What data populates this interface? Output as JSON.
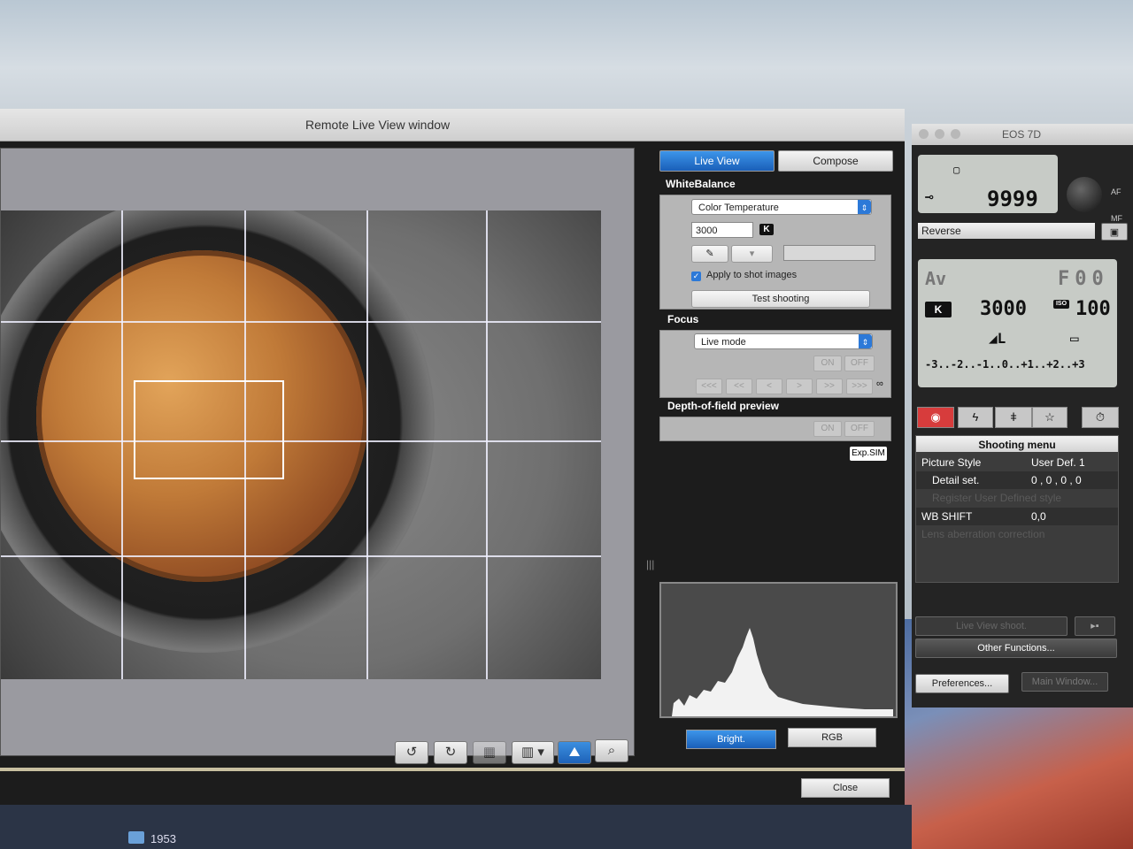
{
  "window_title": "Remote Live View window",
  "toolbar": {
    "rotate_left_icon": "rotate-left-icon",
    "rotate_right_icon": "rotate-right-icon",
    "grid_icon": "grid-icon",
    "aspect_label": "▾",
    "zoom_icon": "magnifier-icon"
  },
  "tabs": {
    "live_view": "Live View",
    "compose": "Compose"
  },
  "white_balance": {
    "label": "WhiteBalance",
    "mode": "Color Temperature",
    "kelvin_value": "3000",
    "kelvin_badge": "K",
    "apply_label": "Apply to shot images",
    "test_button": "Test shooting"
  },
  "focus": {
    "label": "Focus",
    "mode": "Live mode",
    "on": "ON",
    "off": "OFF",
    "steps": [
      "<<<",
      "<<",
      "<",
      ">",
      ">>",
      ">>>"
    ],
    "infinity": "∞"
  },
  "dof": {
    "label": "Depth-of-field preview",
    "on": "ON",
    "off": "OFF"
  },
  "expsim": "Exp.SIM",
  "histogram": {
    "bright_button": "Bright.",
    "rgb_button": "RGB"
  },
  "close_button": "Close",
  "eos": {
    "title": "EOS 7D",
    "shots_remaining": "9999",
    "af_label": "AF",
    "mf_label": "MF",
    "reverse_label": "Reverse",
    "mode": "Av",
    "aperture": "F00",
    "k_badge": "K",
    "white_balance_k": "3000",
    "iso_label": "ISO",
    "iso": "100",
    "exposure_scale": "-3..-2..-1..0..+1..+2..+3",
    "menu": {
      "header": "Shooting menu",
      "rows": [
        {
          "label": "Picture Style",
          "value": "User Def. 1"
        },
        {
          "label": "Detail set.",
          "value": "0 , 0 , 0 , 0"
        },
        {
          "label": "Register User Defined style",
          "value": ""
        },
        {
          "label": "WB SHIFT",
          "value": "0,0"
        },
        {
          "label": "Lens aberration correction",
          "value": ""
        }
      ]
    },
    "live_view_shoot": "Live View shoot.",
    "other_functions": "Other Functions...",
    "preferences": "Preferences...",
    "main_window": "Main Window..."
  },
  "desktop": {
    "folder_label": "1953"
  },
  "colors": {
    "accent_blue": "#2c79d8",
    "panel_bg": "#1c1c1c"
  }
}
